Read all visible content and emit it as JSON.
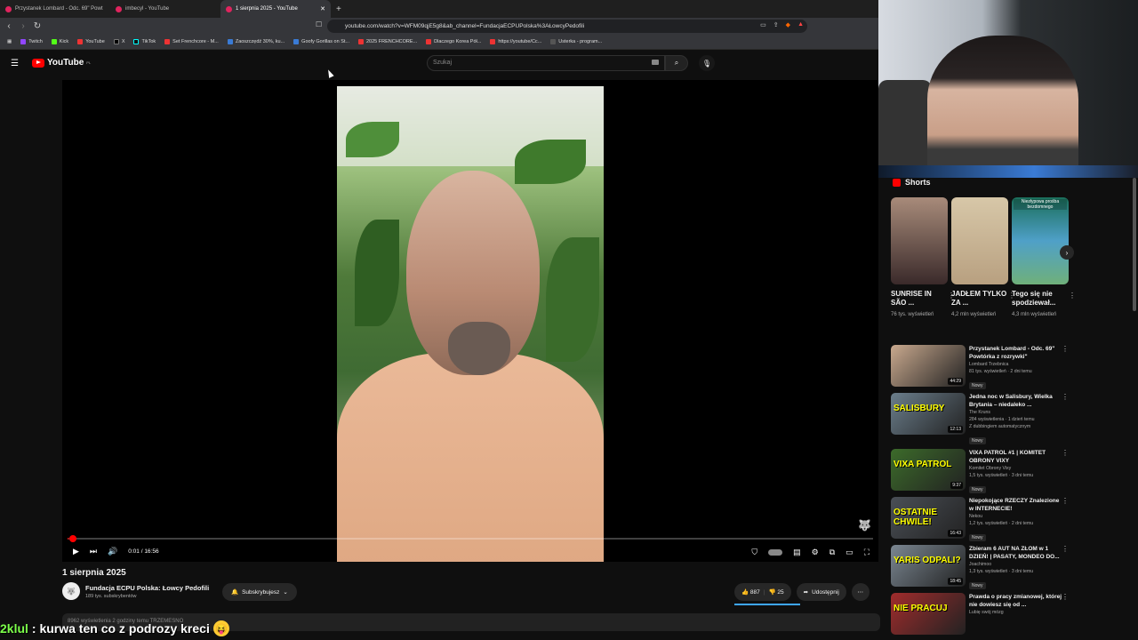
{
  "browser": {
    "tabs": [
      {
        "title": "Przystanek Lombard - Odc. 69\" Powt",
        "active": false
      },
      {
        "title": "imbecyl - YouTube",
        "active": false
      },
      {
        "title": "1 sierpnia 2025 - YouTube",
        "active": true
      }
    ],
    "url": "youtube.com/watch?v=WFM09qjE5g8&ab_channel=FundacjaECPUPolska%3AŁowcyPedofili",
    "bookmarks": [
      "Twitch",
      "Kick",
      "YouTube",
      "X",
      "TikTok",
      "Set Frenchcore - M...",
      "Zaoszczędź 30%, ku...",
      "Goofy Gorillas on St...",
      "2025 FRENCHCORE...",
      "Dlaczego Korea Pół...",
      "https://youtube/Cc...",
      "Usterka - program..."
    ]
  },
  "youtube": {
    "logo": "YouTube",
    "region": "PL",
    "search_placeholder": "Szukaj"
  },
  "player": {
    "current_time": "0:01 / 16:56",
    "progress_fraction": 0.001
  },
  "video": {
    "title": "1 sierpnia 2025",
    "channel": "Fundacja ECPU Polska: Łowcy Pedofili",
    "subscribers": "189 tys. subskrybentów",
    "subscribe_label": "Subskrybujesz",
    "likes": "887",
    "dislikes": "25",
    "share_label": "Udostępnij",
    "description_preview": "8962 wyświetlenia  2 godziny temu  TRZEMESNO"
  },
  "shorts": {
    "header": "Shorts",
    "items": [
      {
        "title": "SUNRISE IN SÃO ...",
        "views": "76 tys. wyświetleń",
        "tag": ""
      },
      {
        "title": "JADŁEM TYLKO ZA ...",
        "views": "4,2 mln wyświetleń",
        "tag": ""
      },
      {
        "title": "Tego się nie spodziewał...",
        "views": "4,3 mln wyświetleń",
        "tag": "Niezłypowa prośba bezdomnego"
      }
    ]
  },
  "recommended": [
    {
      "title": "Przystanek Lombard - Odc. 69\" Powtórka z rozrywki\"",
      "channel": "Lombard Trzebnica",
      "meta": "81 tys. wyświetleń · 2 dni temu",
      "badge": "Nowy",
      "extra": "",
      "duration": "44:29",
      "overlay": "",
      "color": "#c9a98e"
    },
    {
      "title": "Jedna noc w Salisbury, Wielka Brytania – niedaleko ...",
      "channel": "The Kruns",
      "meta": "284 wyświetlenia · 1 dzień temu",
      "badge": "Nowy",
      "extra": "Z dubbingiem automatycznym",
      "duration": "12:13",
      "overlay": "SALISBURY",
      "color": "#6b7e8c"
    },
    {
      "title": "VIXA PATROL #1 | KOMITET OBRONY VIXY",
      "channel": "Komitet Obrony Vixy",
      "meta": "1,5 tys. wyświetleń · 3 dni temu",
      "badge": "Nowy",
      "extra": "",
      "duration": "9:37",
      "overlay": "VIXA PATROL",
      "color": "#3c6b2a"
    },
    {
      "title": "Niepokojące RZECZY Znalezione w INTERNECIE!",
      "channel": "Nekou",
      "meta": "1,2 tys. wyświetleń · 2 dni temu",
      "badge": "Nowy",
      "extra": "",
      "duration": "16:43",
      "overlay": "OSTATNIE CHWILE!",
      "color": "#4a4f56"
    },
    {
      "title": "Zbieram 6 AUT NA ZŁOM w 1 DZIEŃ! | PASATY, MONDEO DO...",
      "channel": "Joachimoo",
      "meta": "1,3 tys. wyświetleń · 3 dni temu",
      "badge": "Nowy",
      "extra": "",
      "duration": "18:45",
      "overlay": "YARIS ODPALI?",
      "color": "#7b8792"
    },
    {
      "title": "Prawda o pracy zmianowej, której nie dowiesz się od ...",
      "channel": "Lubię swój mózg",
      "meta": "",
      "badge": "",
      "extra": "",
      "duration": "",
      "overlay": "NIE PRACUJ",
      "color": "#a12c2c"
    }
  ],
  "chat": {
    "user": "2klul",
    "message": ": kurwa ten co z podrozy kreci"
  }
}
